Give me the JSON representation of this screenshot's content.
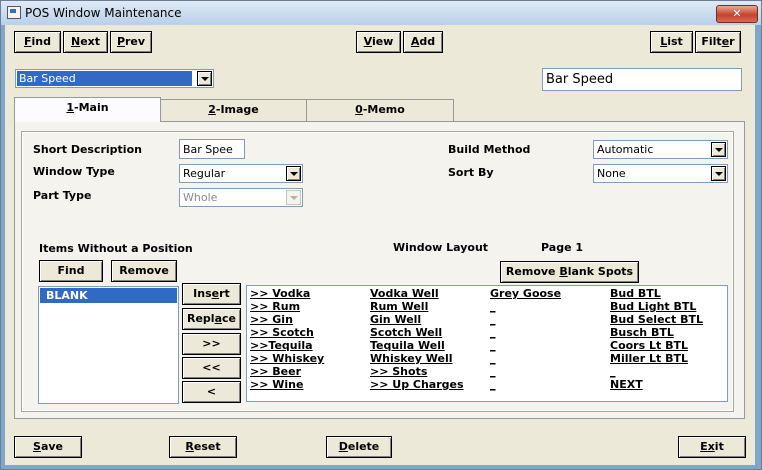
{
  "window": {
    "title": "POS Window Maintenance",
    "close_label": "✕"
  },
  "toolbar": {
    "find": [
      "F",
      "ind"
    ],
    "next": [
      "N",
      "ext"
    ],
    "prev": [
      "P",
      "rev"
    ],
    "view": [
      "V",
      "iew"
    ],
    "add": [
      "A",
      "dd"
    ],
    "list": [
      "L",
      "ist"
    ],
    "filter": [
      "Filt",
      "e",
      "r"
    ]
  },
  "selector": {
    "value": "Bar Speed"
  },
  "name_field": {
    "value": "Bar Speed"
  },
  "tabs": [
    {
      "key": "1",
      "label": "-Main"
    },
    {
      "key": "2",
      "label": "-Image"
    },
    {
      "key": "0",
      "label": "-Memo"
    }
  ],
  "form": {
    "short_description_label": "Short Description",
    "short_description_value": "Bar Spee",
    "window_type_label": "Window Type",
    "window_type_value": "Regular",
    "part_type_label": "Part Type",
    "part_type_value": "Whole",
    "build_method_label": "Build Method",
    "build_method_value": "Automatic",
    "sort_by_label": "Sort By",
    "sort_by_value": "None"
  },
  "items_panel": {
    "title": "Items Without a Position",
    "find_label": "Find",
    "remove_label": "Remove",
    "items": [
      "BLANK"
    ]
  },
  "layout_panel": {
    "title": "Window Layout",
    "page_label": "Page 1",
    "remove_blank_pre": "Remove ",
    "remove_blank_key": "B",
    "remove_blank_post": "lank Spots"
  },
  "move_buttons": {
    "insert": [
      "Ins",
      "e",
      "rt"
    ],
    "replace": [
      "Repl",
      "a",
      "ce"
    ],
    "forward_all": ">>",
    "back_all": "<<",
    "back_one": "<"
  },
  "grid": {
    "col1": [
      ">> Vodka",
      ">> Rum",
      ">> Gin",
      ">> Scotch",
      ">>Tequila",
      ">> Whiskey",
      ">> Beer",
      ">> Wine"
    ],
    "col2": [
      "Vodka Well",
      "Rum Well",
      "Gin Well",
      "Scotch Well",
      "Tequila Well",
      "Whiskey Well",
      ">> Shots",
      ">> Up Charges"
    ],
    "col3": [
      "Grey Goose",
      "_",
      "_",
      "_",
      "_",
      "_",
      "_",
      "_"
    ],
    "col4": [
      "Bud BTL",
      "Bud Light BTL",
      "Bud Select BTL",
      "Busch BTL",
      "Coors Lt BTL",
      "Miller Lt BTL",
      "_",
      "NEXT"
    ]
  },
  "footer": {
    "save": [
      "S",
      "ave"
    ],
    "reset": [
      "R",
      "eset"
    ],
    "delete": [
      "D",
      "elete"
    ],
    "exit": [
      "E",
      "x",
      "it"
    ]
  }
}
